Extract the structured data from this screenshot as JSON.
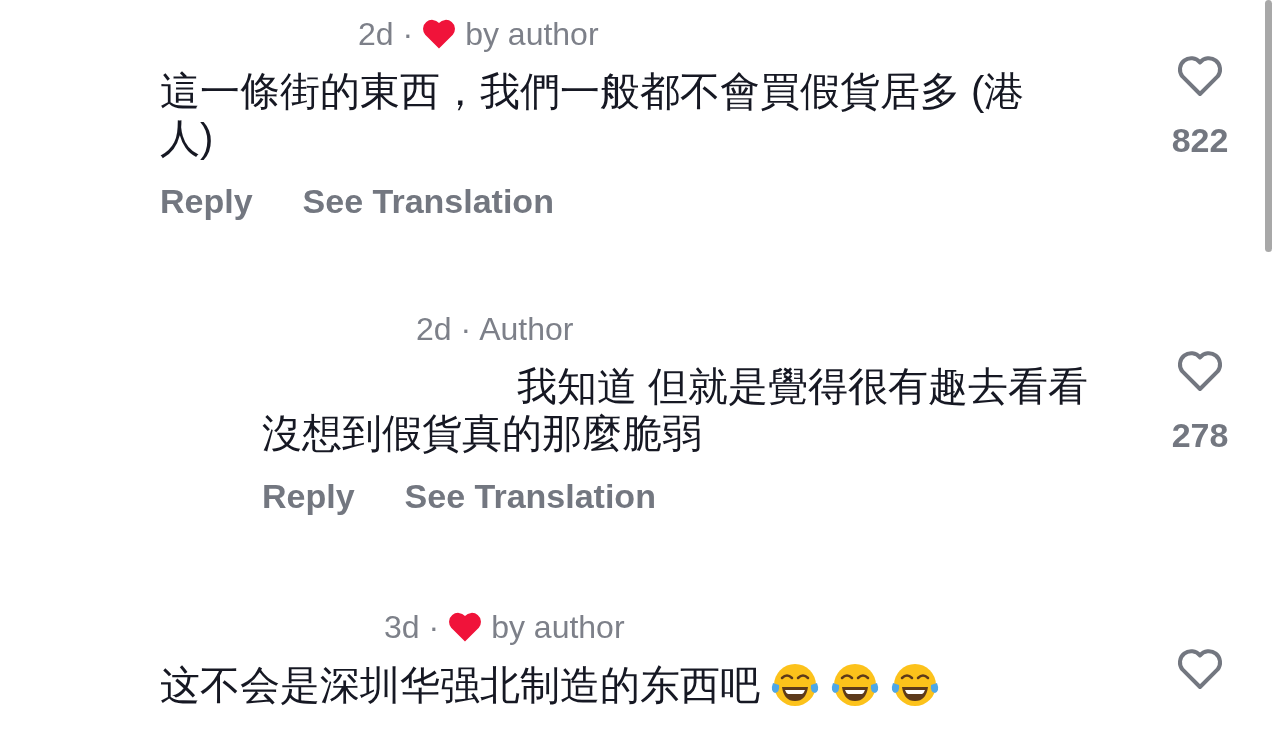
{
  "comments": [
    {
      "time": "2d ·",
      "author_liked": true,
      "tag": "by author",
      "text": "這一條街的東西，我們一般都不會買假貨居多 (港人)",
      "actions": [
        "Reply",
        "See Translation"
      ],
      "liked": false,
      "like_count": "822"
    },
    {
      "time": "2d ·",
      "author_liked": false,
      "tag": "Author",
      "text": "我知道 但就是覺得很有趣去看看沒想到假貨真的那麼脆弱",
      "actions": [
        "Reply",
        "See Translation"
      ],
      "liked": false,
      "like_count": "278"
    },
    {
      "time": "3d ·",
      "author_liked": true,
      "tag": "by author",
      "text": "这不会是深圳华强北制造的东西吧",
      "emojis": [
        {
          "kind": "tears-of-joy"
        },
        {
          "kind": "tears-of-joy"
        },
        {
          "kind": "tears-of-joy"
        }
      ],
      "liked": false
    }
  ]
}
